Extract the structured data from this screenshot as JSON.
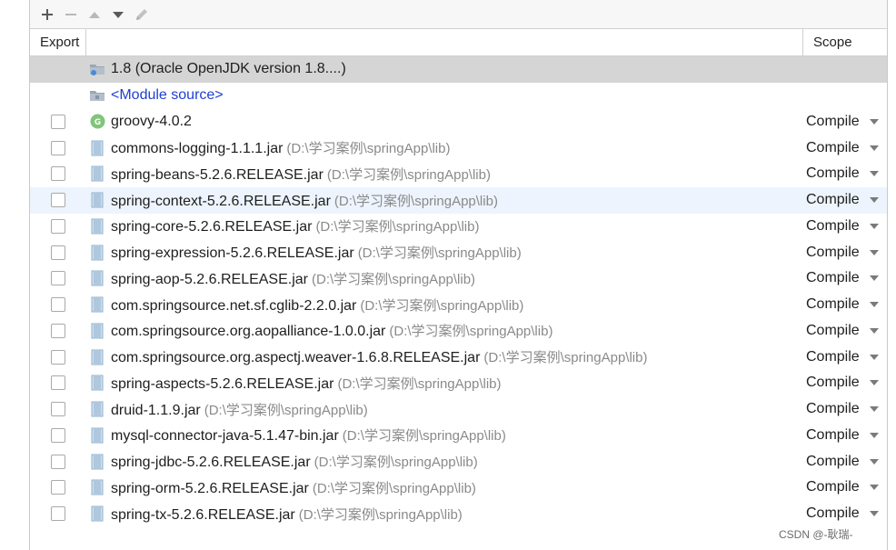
{
  "toolbar": {
    "buttons": [
      {
        "name": "add",
        "icon": "plus-icon"
      },
      {
        "name": "remove",
        "icon": "minus-icon"
      },
      {
        "name": "move-up",
        "icon": "triangle-up-icon"
      },
      {
        "name": "move-down",
        "icon": "triangle-down-icon"
      },
      {
        "name": "edit",
        "icon": "pencil-icon"
      }
    ]
  },
  "header": {
    "export": "Export",
    "scope": "Scope"
  },
  "rows": [
    {
      "kind": "jdk",
      "name": "1.8 (Oracle OpenJDK version 1.8....)",
      "selected": true
    },
    {
      "kind": "module",
      "name": "<Module source>"
    },
    {
      "kind": "lib",
      "icon": "groovy-icon",
      "name": "groovy-4.0.2",
      "path": "",
      "scope": "Compile"
    },
    {
      "kind": "lib",
      "icon": "jar-icon",
      "name": "commons-logging-1.1.1.jar",
      "path": "(D:\\学习案例\\springApp\\lib)",
      "scope": "Compile"
    },
    {
      "kind": "lib",
      "icon": "jar-icon",
      "name": "spring-beans-5.2.6.RELEASE.jar",
      "path": "(D:\\学习案例\\springApp\\lib)",
      "scope": "Compile"
    },
    {
      "kind": "lib",
      "icon": "jar-icon",
      "name": "spring-context-5.2.6.RELEASE.jar",
      "path": "(D:\\学习案例\\springApp\\lib)",
      "scope": "Compile",
      "hover": true
    },
    {
      "kind": "lib",
      "icon": "jar-icon",
      "name": "spring-core-5.2.6.RELEASE.jar",
      "path": "(D:\\学习案例\\springApp\\lib)",
      "scope": "Compile"
    },
    {
      "kind": "lib",
      "icon": "jar-icon",
      "name": "spring-expression-5.2.6.RELEASE.jar",
      "path": "(D:\\学习案例\\springApp\\lib)",
      "scope": "Compile"
    },
    {
      "kind": "lib",
      "icon": "jar-icon",
      "name": "spring-aop-5.2.6.RELEASE.jar",
      "path": "(D:\\学习案例\\springApp\\lib)",
      "scope": "Compile"
    },
    {
      "kind": "lib",
      "icon": "jar-icon",
      "name": "com.springsource.net.sf.cglib-2.2.0.jar",
      "path": "(D:\\学习案例\\springApp\\lib)",
      "scope": "Compile"
    },
    {
      "kind": "lib",
      "icon": "jar-icon",
      "name": "com.springsource.org.aopalliance-1.0.0.jar",
      "path": "(D:\\学习案例\\springApp\\lib)",
      "scope": "Compile"
    },
    {
      "kind": "lib",
      "icon": "jar-icon",
      "name": "com.springsource.org.aspectj.weaver-1.6.8.RELEASE.jar",
      "path": "(D:\\学习案例\\springApp\\lib)",
      "scope": "Compile"
    },
    {
      "kind": "lib",
      "icon": "jar-icon",
      "name": "spring-aspects-5.2.6.RELEASE.jar",
      "path": "(D:\\学习案例\\springApp\\lib)",
      "scope": "Compile"
    },
    {
      "kind": "lib",
      "icon": "jar-icon",
      "name": "druid-1.1.9.jar",
      "path": "(D:\\学习案例\\springApp\\lib)",
      "scope": "Compile"
    },
    {
      "kind": "lib",
      "icon": "jar-icon",
      "name": "mysql-connector-java-5.1.47-bin.jar",
      "path": "(D:\\学习案例\\springApp\\lib)",
      "scope": "Compile"
    },
    {
      "kind": "lib",
      "icon": "jar-icon",
      "name": "spring-jdbc-5.2.6.RELEASE.jar",
      "path": "(D:\\学习案例\\springApp\\lib)",
      "scope": "Compile"
    },
    {
      "kind": "lib",
      "icon": "jar-icon",
      "name": "spring-orm-5.2.6.RELEASE.jar",
      "path": "(D:\\学习案例\\springApp\\lib)",
      "scope": "Compile"
    },
    {
      "kind": "lib",
      "icon": "jar-icon",
      "name": "spring-tx-5.2.6.RELEASE.jar",
      "path": "(D:\\学习案例\\springApp\\lib)",
      "scope": "Compile"
    }
  ],
  "watermark": "CSDN @-耿瑞-",
  "colors": {
    "selected_row": "#d5d5d5",
    "hover_row": "#edf4fd",
    "module_link": "#1f3fd4",
    "path_text": "#8a8a8a",
    "groovy_icon": "#7fc57a",
    "jar_icon": "#8fb2cf"
  }
}
